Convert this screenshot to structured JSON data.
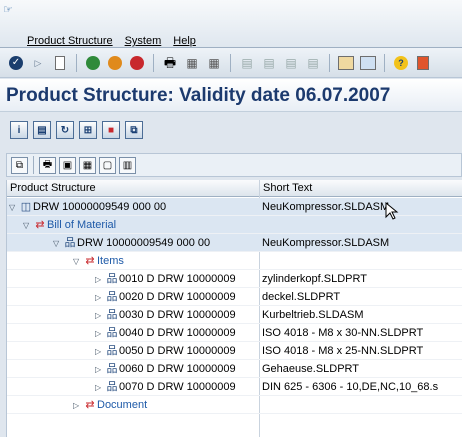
{
  "menubar": {
    "system_glyph": "☞",
    "items": [
      "Product Structure",
      "System",
      "Help"
    ]
  },
  "page": {
    "title": "Product Structure: Validity date 06.07.2007"
  },
  "grid": {
    "columns": [
      "Product Structure",
      "Short Text"
    ],
    "rows": [
      {
        "label": "DRW 10000009549 000 00",
        "short_text": "NeuKompressor.SLDASM"
      },
      {
        "label": "Bill of Material",
        "short_text": ""
      },
      {
        "label": "DRW 10000009549 000 00",
        "short_text": "NeuKompressor.SLDASM"
      },
      {
        "label": "Items",
        "short_text": ""
      },
      {
        "label": "0010 D DRW 10000009",
        "short_text": "zylinderkopf.SLDPRT"
      },
      {
        "label": "0020 D DRW 10000009",
        "short_text": "deckel.SLDPRT"
      },
      {
        "label": "0030 D DRW 10000009",
        "short_text": "Kurbeltrieb.SLDASM"
      },
      {
        "label": "0040 D DRW 10000009",
        "short_text": "ISO 4018 - M8 x 30-NN.SLDPRT"
      },
      {
        "label": "0050 D DRW 10000009",
        "short_text": "ISO 4018 - M8 x 25-NN.SLDPRT"
      },
      {
        "label": "0060 D DRW 10000009",
        "short_text": "Gehaeuse.SLDPRT"
      },
      {
        "label": "0070 D DRW 10000009",
        "short_text": "DIN 625 - 6306 - 10,DE,NC,10_68.s"
      },
      {
        "label": "Document",
        "short_text": ""
      }
    ]
  },
  "colors": {
    "title": "#1c3a6e",
    "link": "#1e5aa8",
    "selected_row": "#dbe6f2"
  }
}
